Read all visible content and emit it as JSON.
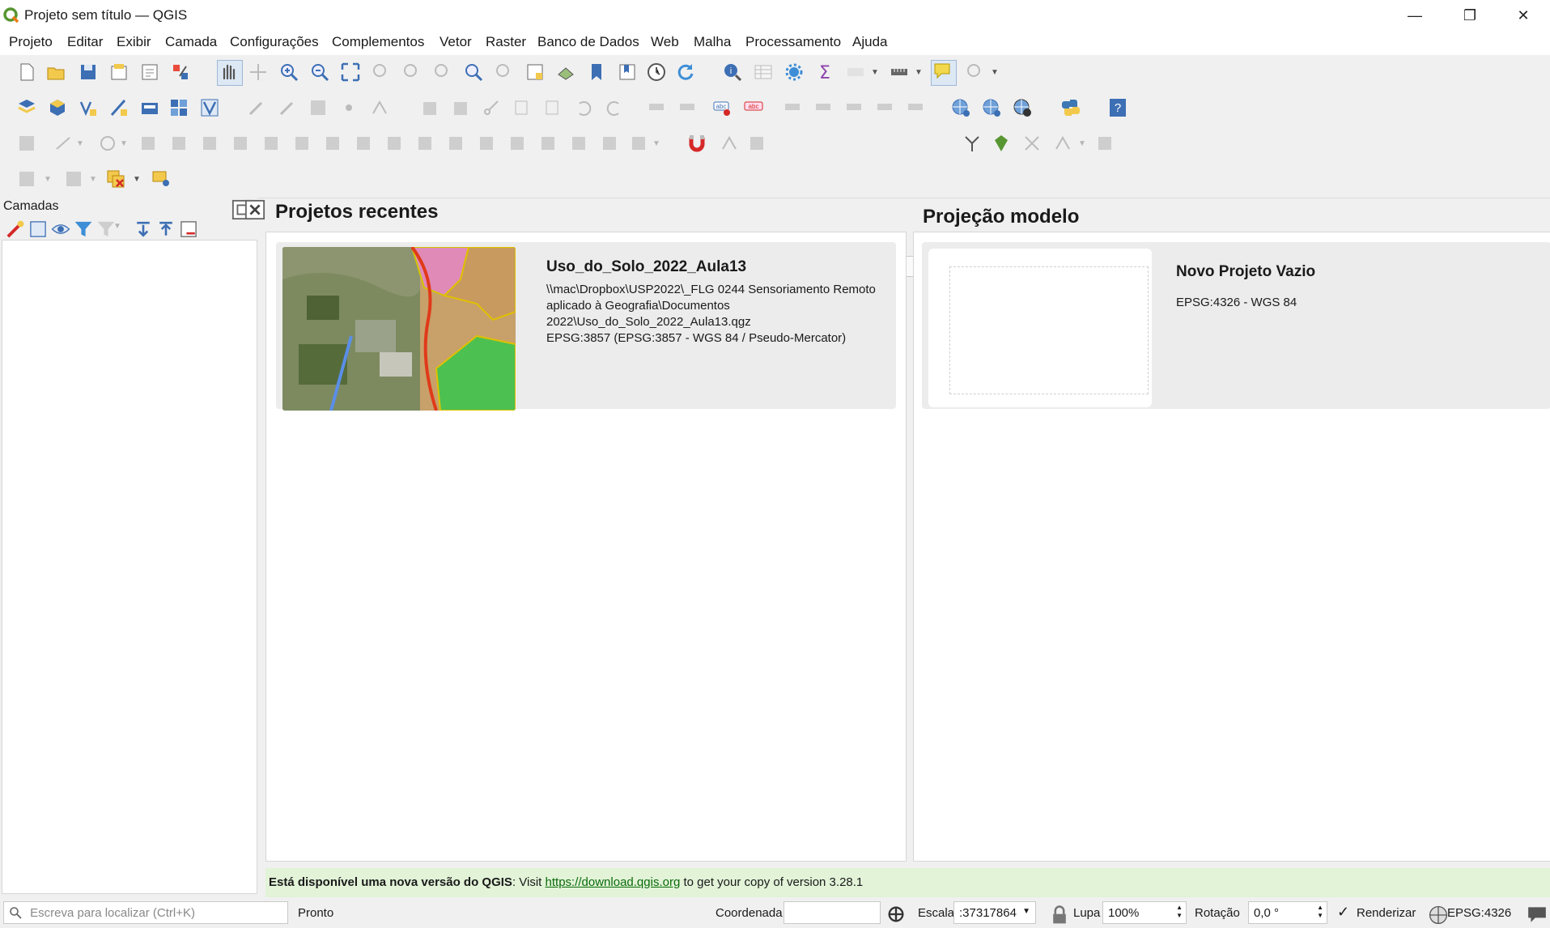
{
  "window": {
    "title": "Projeto sem título — QGIS"
  },
  "menu": [
    "Projeto",
    "Editar",
    "Exibir",
    "Camada",
    "Configurações",
    "Complementos",
    "Vetor",
    "Raster",
    "Banco de Dados",
    "Web",
    "Malha",
    "Processamento",
    "Ajuda"
  ],
  "toolbar": {
    "size_value": "12",
    "unit_value": "px"
  },
  "layers_panel": {
    "title": "Camadas"
  },
  "recent": {
    "heading": "Projetos recentes",
    "items": [
      {
        "title": "Uso_do_Solo_2022_Aula13",
        "path1": "\\\\mac\\Dropbox\\USP2022\\_FLG 0244 Sensoriamento Remoto",
        "path2": "aplicado à Geografia\\Documentos",
        "path3": "2022\\Uso_do_Solo_2022_Aula13.qgz",
        "crs": "EPSG:3857 (EPSG:3857 - WGS 84 / Pseudo-Mercator)"
      }
    ]
  },
  "templates": {
    "heading": "Projeção modelo",
    "items": [
      {
        "title": "Novo Projeto Vazio",
        "crs": "EPSG:4326 - WGS 84"
      }
    ]
  },
  "notice": {
    "bold": "Está disponível uma nova versão do QGIS",
    "pre": ": Visit ",
    "link": "https://download.qgis.org",
    "post": " to get your copy of version 3.28.1"
  },
  "status": {
    "search_placeholder": "Escreva para localizar (Ctrl+K)",
    "ready": "Pronto",
    "coord_label": "Coordenada",
    "coord_value": "",
    "scale_label": "Escala",
    "scale_value": ":37317864",
    "magnifier_label": "Lupa",
    "magnifier_value": "100%",
    "rotation_label": "Rotação",
    "rotation_value": "0,0 °",
    "render_label": "Renderizar",
    "crs": "EPSG:4326"
  },
  "colors": {
    "accent_green": "#589632",
    "notice_bg": "#e2f3d8",
    "link": "#0a6b0a"
  }
}
